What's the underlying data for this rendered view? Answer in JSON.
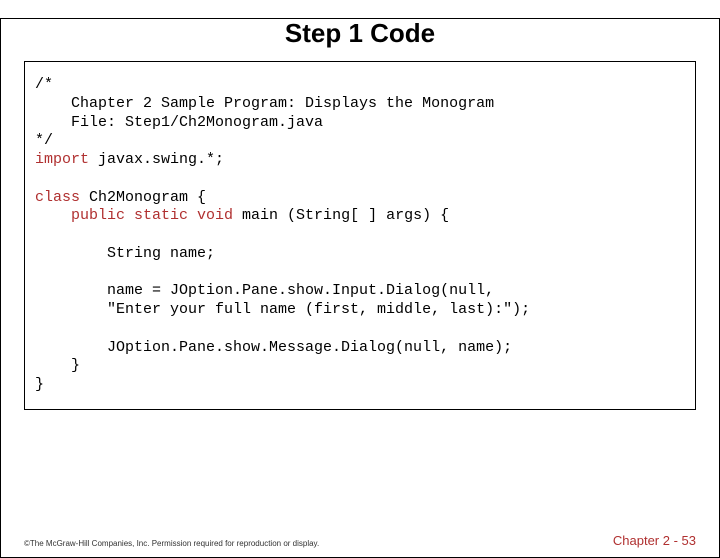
{
  "title": "Step 1 Code",
  "code": {
    "l1": "/*",
    "l2": "    Chapter 2 Sample Program: Displays the Monogram",
    "l3": "    File: Step1/Ch2Monogram.java",
    "l4": "*/",
    "l5a": "import",
    "l5b": " javax.swing.*;",
    "l6a": "class",
    "l6b": " Ch2Monogram {",
    "l7a": "    public static void",
    "l7b": " main (String[ ] args) {",
    "l8": "        String name;",
    "l9a": "        name = JOption.Pane.show.Input.Dialog(null,",
    "l9b": "        \"Enter your full name (first, middle, last):\");",
    "l10": "        JOption.Pane.show.Message.Dialog(null, name);",
    "l11": "    }",
    "l12": "}"
  },
  "footer": {
    "copyright": "©The McGraw-Hill Companies, Inc. Permission required for reproduction or display.",
    "page": "Chapter 2 - 53"
  }
}
